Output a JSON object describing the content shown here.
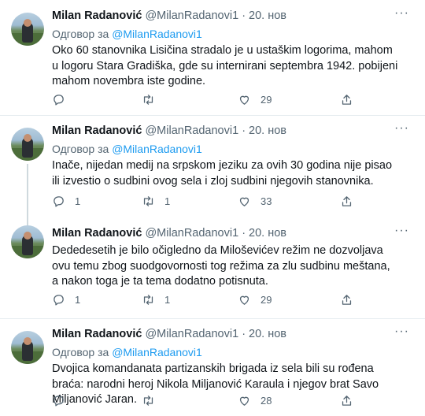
{
  "tweets": [
    {
      "name": "Milan Radanović",
      "handle": "@MilanRadanovi1",
      "date": "· 20. нов",
      "reply_prefix": "Одговор за",
      "reply_mention": "@MilanRadanovi1",
      "text": "Oko 60 stanovnika Lisičina stradalo je u ustaškim logorima, mahom u logoru Stara Gradiška, gde su internirani septembra 1942.  pobijeni mahom novembra iste godine.",
      "replies": "",
      "retweets": "",
      "likes": "29"
    },
    {
      "name": "Milan Radanović",
      "handle": "@MilanRadanovi1",
      "date": "· 20. нов",
      "reply_prefix": "Одговор за",
      "reply_mention": "@MilanRadanovi1",
      "text": "Inače, nijedan medij na srpskom jeziku za ovih 30 godina nije pisao ili izvestio o sudbini ovog sela i zloj sudbini njegovih stanovnika.",
      "replies": "1",
      "retweets": "1",
      "likes": "33"
    },
    {
      "name": "Milan Radanović",
      "handle": "@MilanRadanovi1",
      "date": "· 20. нов",
      "reply_prefix": "",
      "reply_mention": "",
      "text": "Dededesetih je bilo očigledno da Miloševićev režim ne dozvoljava ovu temu zbog suodgovornosti tog režima za zlu sudbinu meštana, a nakon toga je ta tema dodatno potisnuta.",
      "replies": "1",
      "retweets": "1",
      "likes": "29"
    },
    {
      "name": "Milan Radanović",
      "handle": "@MilanRadanovi1",
      "date": "· 20. нов",
      "reply_prefix": "Одговор за",
      "reply_mention": "@MilanRadanovi1",
      "text": "Dvojica komandanata partizanskih brigada iz sela bili su rođena braća: narodni heroj Nikola Miljanović Karaula i njegov brat Savo Miljanović Jaran.",
      "replies": "",
      "retweets": "",
      "likes": "28"
    }
  ],
  "icons": {
    "reply": "reply-icon",
    "retweet": "retweet-icon",
    "like": "heart-icon",
    "share": "share-icon",
    "more": "more-icon"
  },
  "colors": {
    "link": "#1d9bf0",
    "secondary_text": "#536471",
    "divider": "#e6ecf0"
  }
}
